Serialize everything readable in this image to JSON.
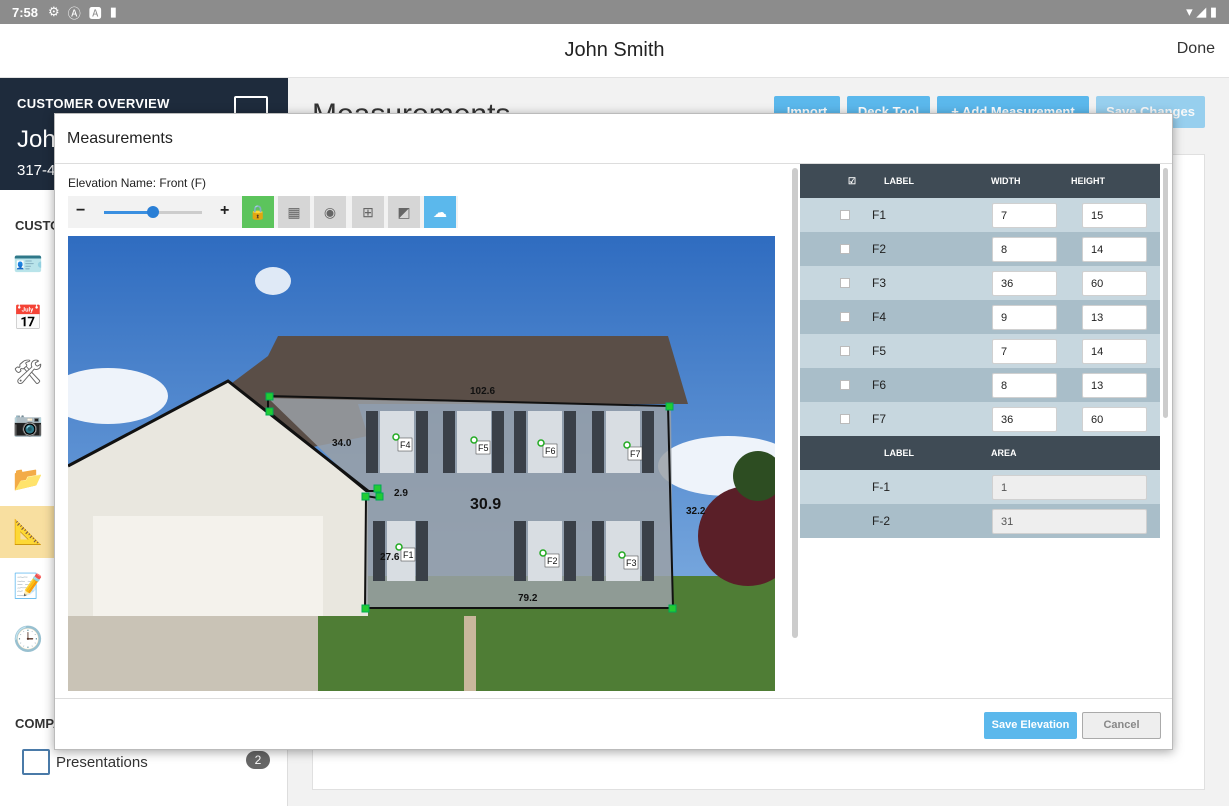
{
  "status": {
    "time": "7:58",
    "icons": [
      "gear-icon",
      "a-circle-icon",
      "a-square-icon",
      "sd-card-icon"
    ]
  },
  "app": {
    "title": "John Smith",
    "done_label": "Done"
  },
  "sidebar": {
    "header_label": "CUSTOMER OVERVIEW",
    "customer_name_partial": "Joh",
    "phone_partial": "317-4",
    "section_label_partial": "CUSTO",
    "company_label_partial": "COMPA",
    "icons": [
      "contact-card-icon",
      "calendar-icon",
      "tools-icon",
      "camera-icon",
      "folder-icon",
      "ruler-pencil-icon",
      "edit-note-icon",
      "clock-icon"
    ],
    "active_icon": "ruler-pencil-icon",
    "presentations_label": "Presentations",
    "presentations_count": "2"
  },
  "main": {
    "heading_partial": "Measurements",
    "buttons": [
      "Import",
      "Deck Tool",
      "+ Add Measurement",
      "Save Changes"
    ]
  },
  "modal": {
    "title": "Measurements",
    "elevation_name": "Elevation Name: Front (F)",
    "zoom": {
      "minus": "−",
      "plus": "+",
      "level": 0.5
    },
    "tools": [
      "lock-icon",
      "grid-icon",
      "tape-measure-icon",
      "window-icon",
      "siding-icon",
      "cloud-icon"
    ],
    "drawing_labels": {
      "top": "102.6",
      "left_slope": "34.0",
      "small": "2.9",
      "area": "30.9",
      "left_side": "27.6",
      "bottom": "79.2",
      "right": "32.2"
    },
    "openings": [
      "F1",
      "F2",
      "F3",
      "F4",
      "F5",
      "F6",
      "F7"
    ],
    "table": {
      "headers": [
        "LABEL",
        "WIDTH",
        "HEIGHT"
      ],
      "rows": [
        {
          "label": "F1",
          "width": "7",
          "height": "15"
        },
        {
          "label": "F2",
          "width": "8",
          "height": "14"
        },
        {
          "label": "F3",
          "width": "36",
          "height": "60"
        },
        {
          "label": "F4",
          "width": "9",
          "height": "13"
        },
        {
          "label": "F5",
          "width": "7",
          "height": "14"
        },
        {
          "label": "F6",
          "width": "8",
          "height": "13"
        },
        {
          "label": "F7",
          "width": "36",
          "height": "60"
        }
      ],
      "area_headers": [
        "LABEL",
        "AREA"
      ],
      "area_rows": [
        {
          "label": "F-1",
          "area": "1"
        },
        {
          "label": "F-2",
          "area": "31"
        }
      ]
    },
    "save_label": "Save Elevation",
    "cancel_label": "Cancel"
  }
}
